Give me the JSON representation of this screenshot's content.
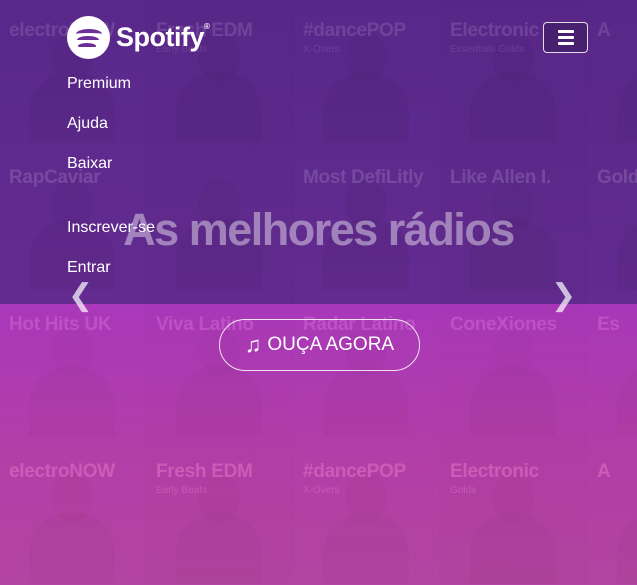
{
  "brand": {
    "name": "Spotify",
    "mark": "®"
  },
  "nav": {
    "toggle_icon": "hamburger-menu-icon",
    "links": [
      "Premium",
      "Ajuda",
      "Baixar",
      "Inscrever-se",
      "Entrar"
    ]
  },
  "hero": {
    "headline": "As melhores rádios",
    "cta_label": "OUÇA AGORA",
    "cta_icon": "music-note-icon",
    "prev_icon": "chevron-left-icon",
    "next_icon": "chevron-right-icon"
  },
  "playlists": [
    {
      "title": "electroNOW",
      "subtitle": ""
    },
    {
      "title": "Fresh EDM",
      "subtitle": "Early Beats"
    },
    {
      "title": "#dancePOP",
      "subtitle": "X-Overs"
    },
    {
      "title": "Electronic",
      "subtitle": "Essentials Golds"
    },
    {
      "title": "A",
      "subtitle": ""
    },
    {
      "title": "RapCaviar",
      "subtitle": ""
    },
    {
      "title": "",
      "subtitle": ""
    },
    {
      "title": "Most DefiLitly",
      "subtitle": ""
    },
    {
      "title": "Like Allen I.",
      "subtitle": ""
    },
    {
      "title": "Gold",
      "subtitle": ""
    },
    {
      "title": "Hot Hits UK",
      "subtitle": ""
    },
    {
      "title": "Viva Latino",
      "subtitle": ""
    },
    {
      "title": "Radar Latino",
      "subtitle": ""
    },
    {
      "title": "ConeXiones",
      "subtitle": ""
    },
    {
      "title": "Es",
      "subtitle": ""
    },
    {
      "title": "electroNOW",
      "subtitle": ""
    },
    {
      "title": "Fresh EDM",
      "subtitle": "Early Beats"
    },
    {
      "title": "#dancePOP",
      "subtitle": "X-Overs"
    },
    {
      "title": "Electronic",
      "subtitle": "Golds"
    },
    {
      "title": "A",
      "subtitle": ""
    }
  ],
  "colors": {
    "overlay_top": "#5a2a8a",
    "overlay_bottom": "#d24ab4",
    "text": "#ffffff"
  }
}
